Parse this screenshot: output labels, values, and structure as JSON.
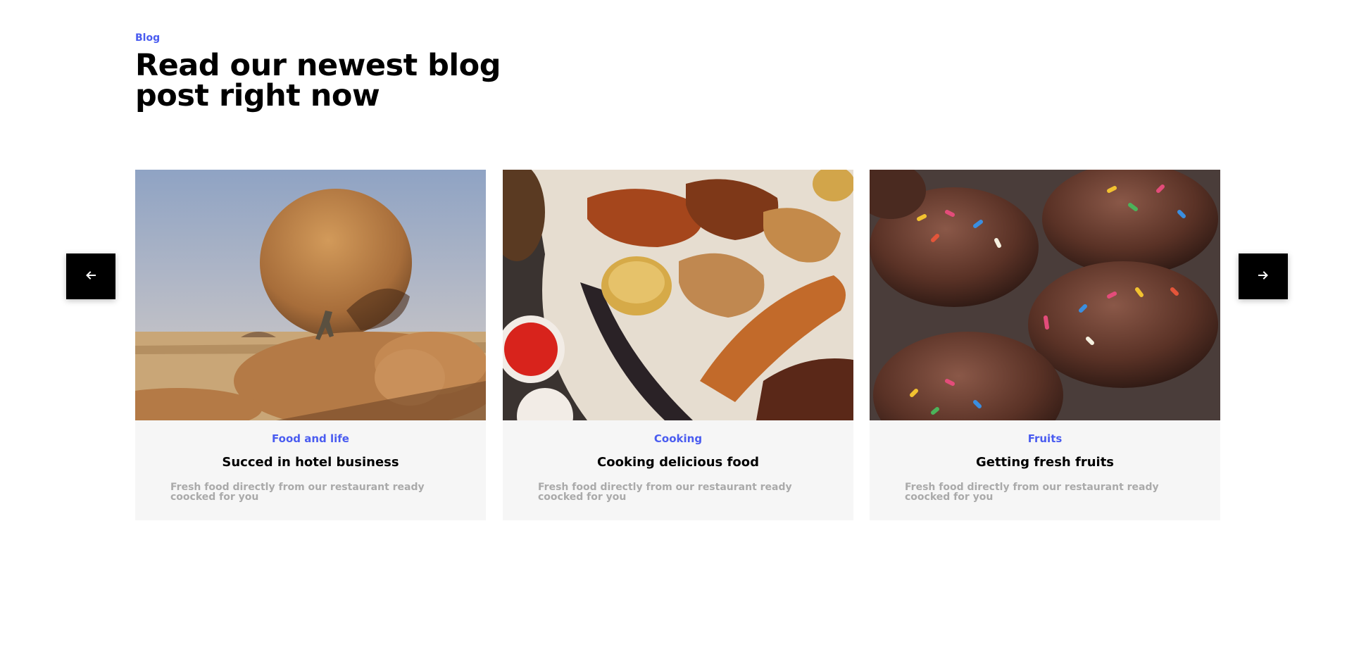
{
  "section": {
    "eyebrow": "Blog",
    "heading": "Read our newest blog post right now"
  },
  "carousel": {
    "prev_icon": "arrow-left-icon",
    "next_icon": "arrow-right-icon"
  },
  "posts": [
    {
      "category": "Food and life",
      "title": "Succed in hotel business",
      "excerpt": "Fresh food directly from our restaurant ready coocked for you",
      "image": "desert-boulder-photo"
    },
    {
      "category": "Cooking",
      "title": "Cooking delicious food",
      "excerpt": "Fresh food directly from our restaurant ready coocked for you",
      "image": "grilled-meat-photo"
    },
    {
      "category": "Fruits",
      "title": "Getting fresh fruits",
      "excerpt": "Fresh food directly from our restaurant ready coocked for you",
      "image": "chocolate-cupcakes-photo"
    }
  ],
  "colors": {
    "accent": "#4a5cf0",
    "card_bg": "#f6f6f6",
    "excerpt": "#aaaaaa",
    "nav_bg": "#000000"
  }
}
